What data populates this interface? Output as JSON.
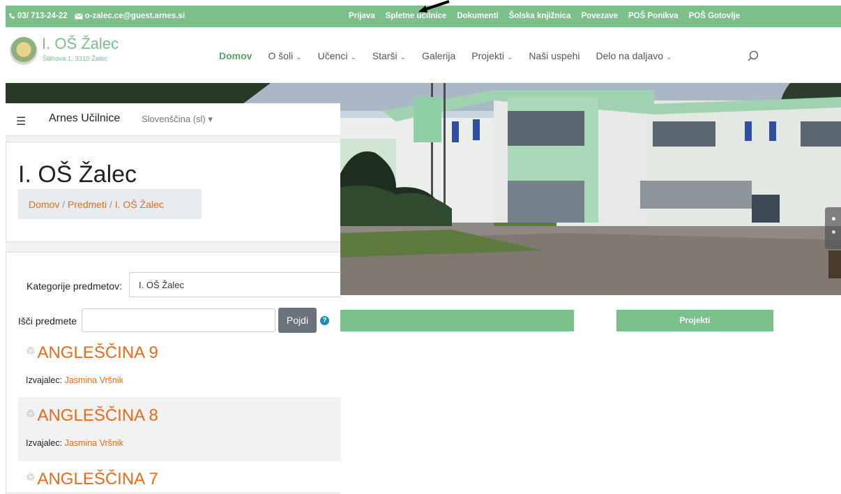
{
  "topbar": {
    "phone": "03/ 713-24-22",
    "email": "o-zalec.ce@guest.arnes.si",
    "links": [
      "Prijava",
      "Spletne učilnice",
      "Dokumenti",
      "Šolska knjižnica",
      "Povezave",
      "POŠ Ponikva",
      "POŠ Gotovlje"
    ]
  },
  "header": {
    "school_name": "I. OŠ Žalec",
    "address": "Šilihova 1, 3310 Žalec",
    "nav": [
      {
        "label": "Domov",
        "active": true
      },
      {
        "label": "O šoli",
        "dropdown": true
      },
      {
        "label": "Učenci",
        "dropdown": true
      },
      {
        "label": "Starši",
        "dropdown": true
      },
      {
        "label": "Galerija"
      },
      {
        "label": "Projekti",
        "dropdown": true
      },
      {
        "label": "Naši uspehi"
      },
      {
        "label": "Delo na daljavo",
        "dropdown": true
      }
    ],
    "search_icon": "search-icon"
  },
  "hero": {
    "projekti_label": "Projekti"
  },
  "moodle": {
    "brand": "Arnes Učilnice",
    "language": "Slovenščina (sl)",
    "page_title": "I. OŠ Žalec",
    "breadcrumb": [
      "Domov",
      "Predmeti",
      "I. OŠ Žalec"
    ],
    "category_label": "Kategorije predmetov:",
    "category_value": "I. OŠ Žalec",
    "search_label": "Išči predmete",
    "search_value": "",
    "go_button": "Pojdi",
    "help_icon": "?",
    "teacher_label": "Izvajalec:",
    "courses": [
      {
        "name": "ANGLEŠČINA 9",
        "teacher": "Jasmina Vršnik"
      },
      {
        "name": "ANGLEŠČINA 8",
        "teacher": "Jasmina Vršnik"
      },
      {
        "name": "ANGLEŠČINA 7",
        "teacher": ""
      }
    ]
  },
  "colors": {
    "brand_green": "#7bbf8b",
    "link_orange": "#e86a1a"
  }
}
